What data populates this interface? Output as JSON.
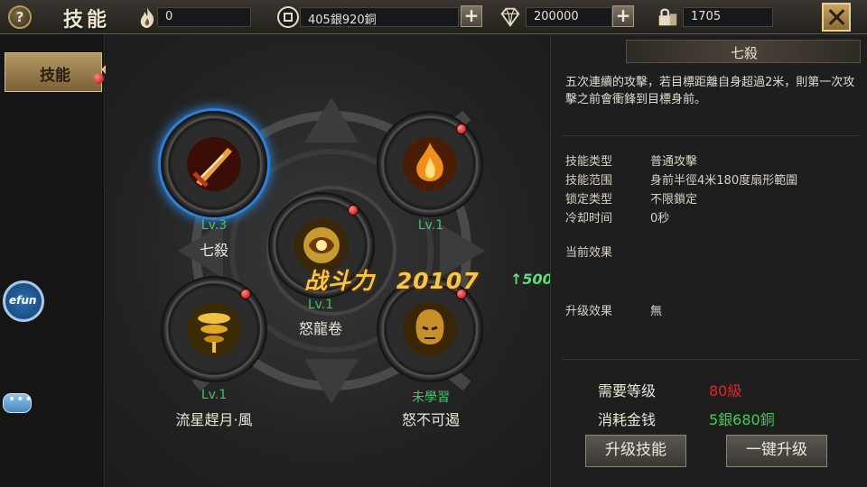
{
  "topbar": {
    "title": "技能",
    "help_icon": "question-icon",
    "resources": [
      {
        "icon": "flame-icon",
        "value": "0",
        "has_plus": false
      },
      {
        "icon": "coin-icon",
        "value": "405銀920銅",
        "has_plus": true
      },
      {
        "icon": "diamond-icon",
        "value": "200000",
        "has_plus": true
      },
      {
        "icon": "lock-icon",
        "value": "1705",
        "has_plus": false
      }
    ]
  },
  "sidebar": {
    "tab_label": "技能"
  },
  "float_buttons": {
    "efun_label": "efun",
    "chat_icon": "chat-bubble-icon"
  },
  "skills": [
    {
      "name": "七殺",
      "level": "Lv.3",
      "selected": true,
      "red_dot": false,
      "color": "#b73a1a"
    },
    {
      "name": "",
      "level": "Lv.1",
      "selected": false,
      "red_dot": true,
      "color": "#e07a10"
    },
    {
      "name": "怒龍卷",
      "level": "Lv.1",
      "selected": false,
      "red_dot": true,
      "color": "#c89a30"
    },
    {
      "name": "流星趕月·風",
      "level": "Lv.1",
      "selected": false,
      "red_dot": true,
      "color": "#d4a020"
    },
    {
      "name": "怒不可遏",
      "level": "未學習",
      "selected": false,
      "red_dot": true,
      "color": "#a67a1a"
    }
  ],
  "combat_power": {
    "label": "战斗力",
    "value": "20107",
    "gain": "↑500"
  },
  "detail": {
    "title": "七殺",
    "description": "五次連續的攻擊，若目標距離自身超過2米，則第一次攻擊之前會衝鋒到目標身前。",
    "attributes": [
      {
        "key": "技能类型",
        "value": "普通攻擊"
      },
      {
        "key": "技能范围",
        "value": "身前半徑4米180度扇形範圍"
      },
      {
        "key": "锁定类型",
        "value": "不限鎖定"
      },
      {
        "key": "冷却时间",
        "value": "0秒"
      }
    ],
    "current_effect_label": "当前效果",
    "upgrade_effect_label": "升级效果",
    "upgrade_effect_value": "無",
    "requirements": {
      "level_label": "需要等级",
      "level_value": "80級",
      "level_color": "#e02828",
      "cost_label": "消耗金钱",
      "cost_value": "5銀680銅",
      "cost_color": "#3fcf4f"
    },
    "buttons": {
      "upgrade": "升级技能",
      "upgrade_all": "一键升级"
    }
  }
}
